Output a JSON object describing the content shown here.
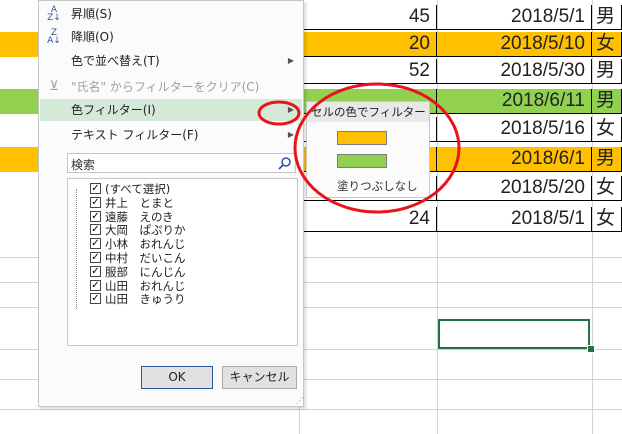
{
  "colors": {
    "orange": "#ffc000",
    "green": "#92d050",
    "selection": "#217346",
    "annotation": "#e8141b"
  },
  "table_rows": [
    {
      "age": "45",
      "date": "2018/5/1",
      "gender": "男",
      "fill": "none"
    },
    {
      "age": "20",
      "date": "2018/5/10",
      "gender": "女",
      "fill": "orange"
    },
    {
      "age": "52",
      "date": "2018/5/30",
      "gender": "男",
      "fill": "none"
    },
    {
      "age": "",
      "date": "2018/6/11",
      "gender": "男",
      "fill": "green"
    },
    {
      "age": "",
      "date": "2018/5/16",
      "gender": "女",
      "fill": "none"
    },
    {
      "age": "",
      "date": "2018/6/1",
      "gender": "男",
      "fill": "orange"
    },
    {
      "age": "",
      "date": "2018/5/20",
      "gender": "女",
      "fill": "none"
    },
    {
      "age": "24",
      "date": "2018/5/1",
      "gender": "女",
      "fill": "none"
    }
  ],
  "menu": {
    "sort_asc": "昇順(S)",
    "sort_desc": "降順(O)",
    "sort_by_color": "色で並べ替え(T)",
    "clear_filter": "\"氏名\" からフィルターをクリア(C)",
    "color_filter": "色フィルター(I)",
    "text_filter": "テキスト フィルター(F)",
    "search_placeholder": "検索",
    "list_items": [
      "(すべて選択)",
      "井上　とまと",
      "遠藤　えのき",
      "大岡　ぱぷりか",
      "小林　おれんじ",
      "中村　だいこん",
      "服部　にんじん",
      "山田　おれんじ",
      "山田　きゅうり"
    ],
    "ok": "OK",
    "cancel": "キャンセル",
    "icon_asc": "sort-ascending-icon",
    "icon_desc": "sort-descending-icon",
    "icon_clear": "clear-filter-icon"
  },
  "submenu": {
    "header": "セルの色でフィルター",
    "swatches": [
      "orange",
      "green"
    ],
    "no_fill": "塗りつぶしなし"
  }
}
